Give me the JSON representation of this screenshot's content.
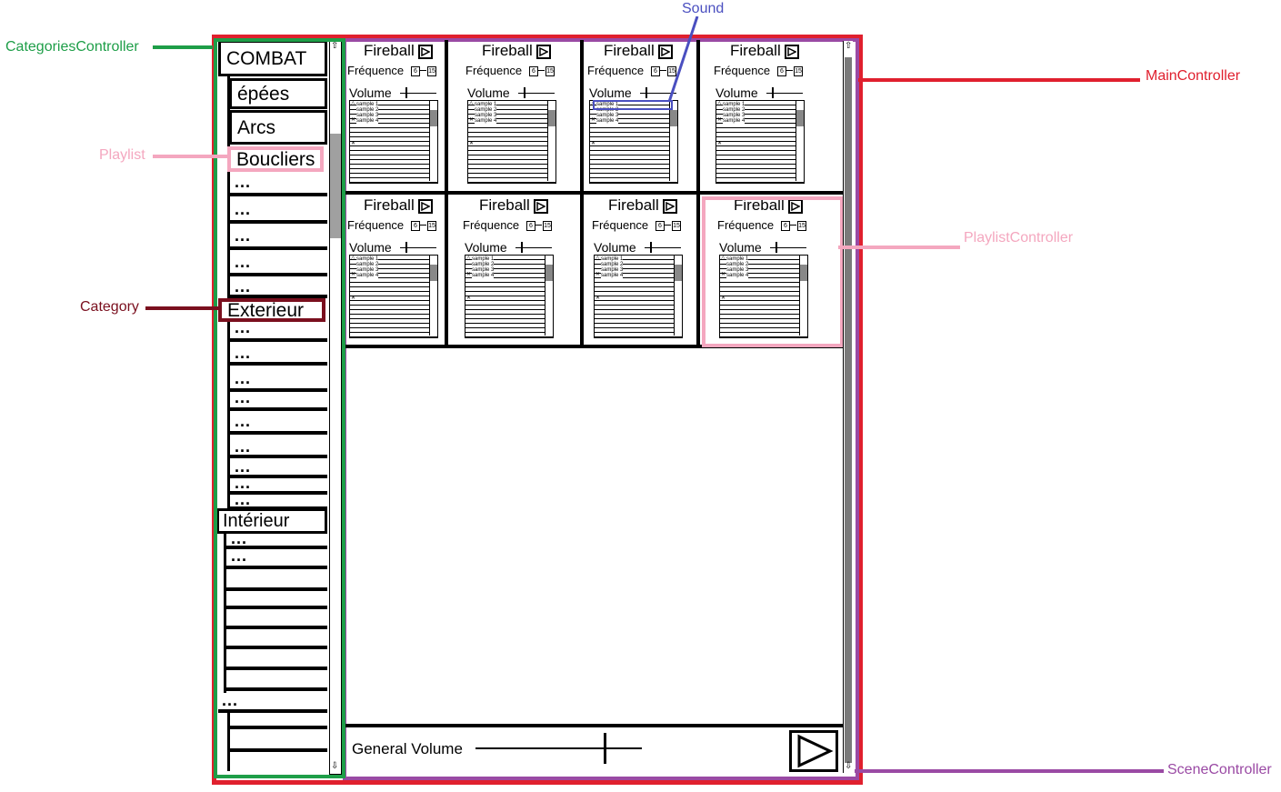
{
  "annotations": {
    "categories_controller": "CategoriesController",
    "playlist": "Playlist",
    "category": "Category",
    "sound": "Sound",
    "main_controller": "MainController",
    "playlist_controller": "PlaylistController",
    "scene_controller": "SceneController"
  },
  "colors": {
    "categories_controller": "#1e9e48",
    "playlist": "#f4a7bf",
    "category": "#7a0f1e",
    "sound": "#4a4fc0",
    "main_controller": "#e0202e",
    "playlist_controller": "#f4a7bf",
    "scene_controller": "#9a4aa4"
  },
  "sidebar": {
    "combat": "COMBAT",
    "epees": "épées",
    "arcs": "Arcs",
    "boucliers": "Boucliers",
    "exterieur": "Exterieur",
    "interieur": "Intérieur",
    "ellipsis": "..."
  },
  "panels": {
    "title": "Fireball",
    "frequence": "Fréquence",
    "freq_min": "6",
    "freq_max": "15",
    "volume": "Volume",
    "samples": [
      "sample 1",
      "sample 2",
      "sample 3",
      "sample 4"
    ]
  },
  "bottom": {
    "general_volume": "General Volume"
  }
}
